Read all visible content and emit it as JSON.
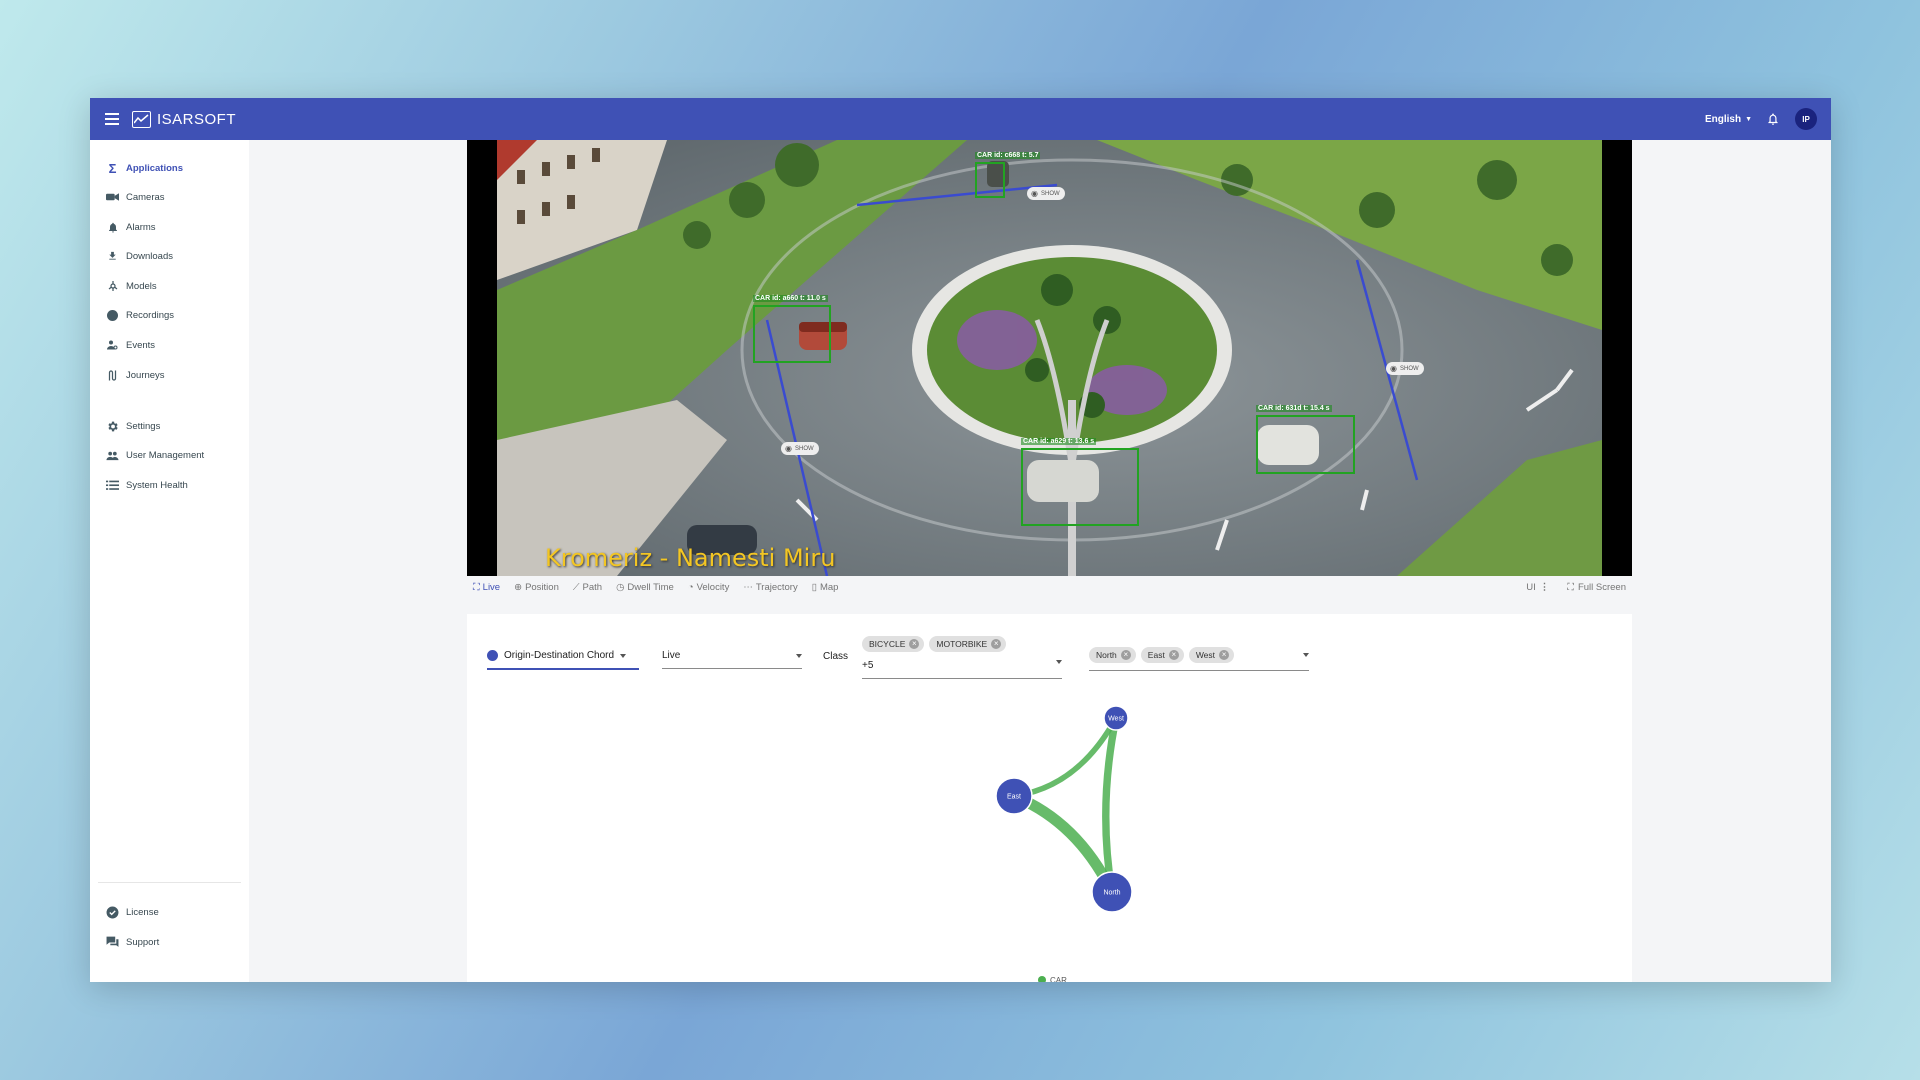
{
  "header": {
    "brand": "ISARSOFT",
    "language": "English",
    "avatar_initials": "IP"
  },
  "sidebar": {
    "items": [
      {
        "label": "Applications",
        "icon": "sigma-icon"
      },
      {
        "label": "Cameras",
        "icon": "camera-icon"
      },
      {
        "label": "Alarms",
        "icon": "bell-icon"
      },
      {
        "label": "Downloads",
        "icon": "download-icon"
      },
      {
        "label": "Models",
        "icon": "models-icon"
      },
      {
        "label": "Recordings",
        "icon": "record-icon"
      },
      {
        "label": "Events",
        "icon": "events-icon"
      },
      {
        "label": "Journeys",
        "icon": "journeys-icon"
      },
      {
        "label": "Settings",
        "icon": "gear-icon"
      },
      {
        "label": "User Management",
        "icon": "users-icon"
      },
      {
        "label": "System Health",
        "icon": "list-icon"
      }
    ],
    "bottom_items": [
      {
        "label": "License",
        "icon": "verified-icon"
      },
      {
        "label": "Support",
        "icon": "chat-icon"
      }
    ],
    "active_index": 0
  },
  "video": {
    "caption": "Kromeriz - Namesti Miru",
    "detections": [
      {
        "label": "CAR id: a660 t: 11.0 s"
      },
      {
        "label": "CAR id: a629 t: 13.6 s"
      },
      {
        "label": "CAR id: 631d t: 15.4 s"
      },
      {
        "label": "CAR id: c668 t: 5.7"
      }
    ],
    "show_chip_label": "SHOW"
  },
  "tabs": {
    "items": [
      "Live",
      "Position",
      "Path",
      "Dwell Time",
      "Velocity",
      "Trajectory",
      "Map"
    ],
    "active": "Live",
    "ui_label": "UI",
    "fullscreen_label": "Full Screen"
  },
  "controls": {
    "view_select": "Origin-Destination Chord",
    "mode_select": "Live",
    "class_label": "Class",
    "class_chips": [
      "BICYCLE",
      "MOTORBIKE"
    ],
    "class_more": "+5",
    "zone_chips": [
      "North",
      "East",
      "West"
    ]
  },
  "chart_data": {
    "type": "chord",
    "nodes": [
      "West",
      "East",
      "North"
    ],
    "flows": [
      {
        "from": "East",
        "to": "West",
        "weight": 2
      },
      {
        "from": "East",
        "to": "North",
        "weight": 5
      },
      {
        "from": "West",
        "to": "North",
        "weight": 3
      }
    ],
    "legend": [
      "CAR"
    ],
    "colors": {
      "node": "#3f51b5",
      "flow": "#4caf50"
    }
  },
  "colors": {
    "primary": "#3f51b5",
    "accent_green": "#4caf50",
    "caption": "#f3c623"
  }
}
